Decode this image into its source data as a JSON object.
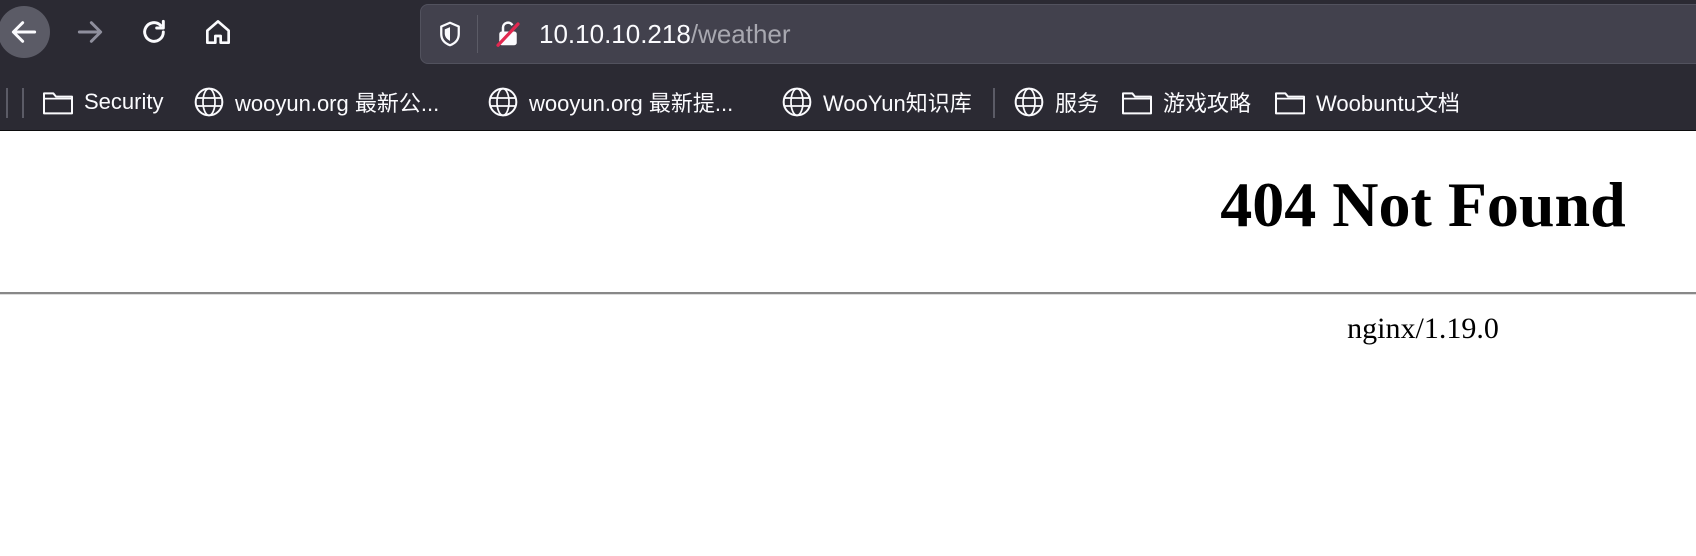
{
  "toolbar": {
    "back_label": "Back",
    "forward_label": "Forward",
    "reload_label": "Reload",
    "home_label": "Home"
  },
  "url_bar": {
    "host": "10.10.10.218",
    "path": "/weather"
  },
  "bookmarks": [
    {
      "label": "Security",
      "icon": "folder-icon"
    },
    {
      "label": "wooyun.org 最新公...",
      "icon": "globe-icon"
    },
    {
      "label": "wooyun.org 最新提...",
      "icon": "globe-icon"
    },
    {
      "label": "WooYun知识库",
      "icon": "globe-icon"
    },
    {
      "label": "服务",
      "icon": "globe-icon"
    },
    {
      "label": "游戏攻略",
      "icon": "folder-icon"
    },
    {
      "label": "Woobuntu文档",
      "icon": "folder-icon"
    }
  ],
  "page": {
    "title": "404 Not Found",
    "server": "nginx/1.19.0"
  },
  "colors": {
    "chrome_bg": "#2b2a33",
    "url_bg": "#42414d",
    "text_light": "#fbfbfe",
    "text_dim": "#a8a8b0",
    "insecure_slash": "#e22850"
  }
}
